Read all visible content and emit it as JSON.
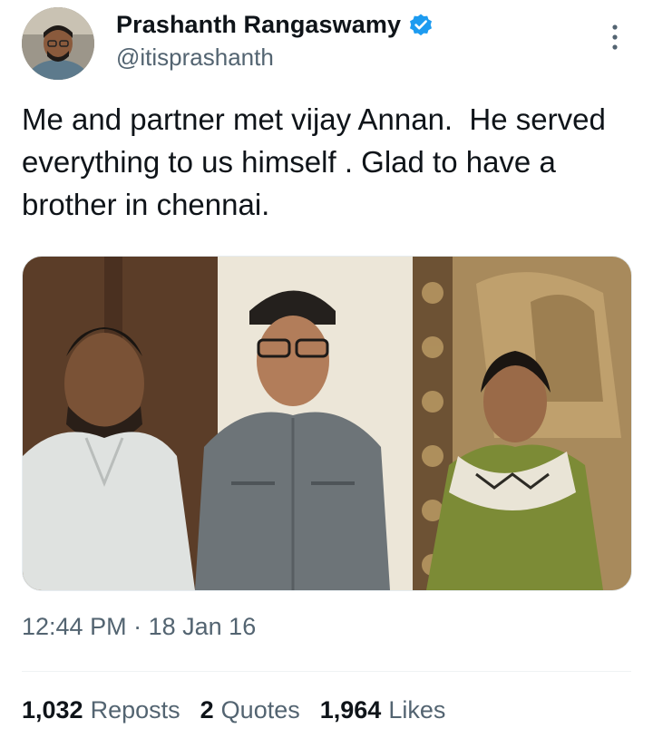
{
  "author": {
    "display_name": "Prashanth Rangaswamy",
    "handle": "@itisprashanth",
    "verified_icon": "verified-badge-icon",
    "avatar_icon": "avatar"
  },
  "menu": {
    "icon": "more-vertical-icon"
  },
  "tweet": {
    "text": "Me and partner met vijay Annan.  He served everything to us himself . Glad to have a brother in chennai."
  },
  "meta": {
    "time": "12:44 PM",
    "separator": "·",
    "date": "18 Jan 16"
  },
  "stats": {
    "reposts_count": "1,032",
    "reposts_label": "Reposts",
    "quotes_count": "2",
    "quotes_label": "Quotes",
    "likes_count": "1,964",
    "likes_label": "Likes"
  },
  "colors": {
    "text_primary": "#0f1419",
    "text_secondary": "#536471",
    "verified_blue": "#1d9bf0",
    "divider": "#eff3f4"
  }
}
